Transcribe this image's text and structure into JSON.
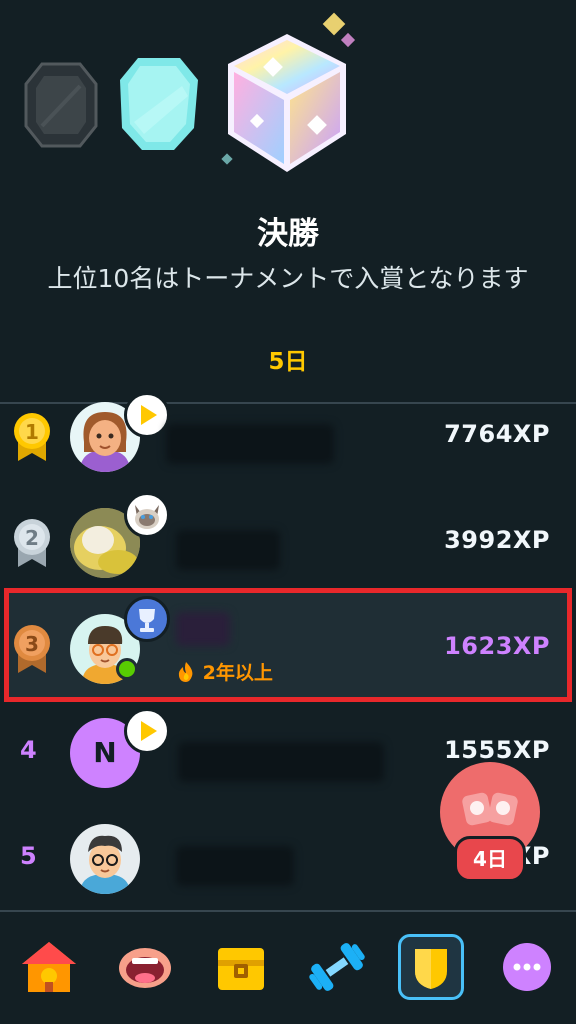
{
  "league": {
    "title": "決勝",
    "subtitle": "上位10名はトーナメントで入賞となります",
    "days_left": "5日"
  },
  "leaderboard": [
    {
      "rank": "1",
      "name": "",
      "xp": "7764XP"
    },
    {
      "rank": "2",
      "name": "",
      "xp": "3992XP"
    },
    {
      "rank": "3",
      "name": "",
      "xp": "1623XP",
      "streak": "2年以上"
    },
    {
      "rank": "4",
      "name": "",
      "xp": "1555XP",
      "initial": "N"
    },
    {
      "rank": "5",
      "name": "",
      "xp": "XP"
    }
  ],
  "floating": {
    "days": "4日"
  },
  "nav": {
    "items": [
      "home-icon",
      "speak-icon",
      "treasure-chest-icon",
      "dumbbell-icon",
      "shield-icon",
      "more-icon"
    ]
  },
  "colors": {
    "background": "#131f24",
    "gold": "#ffc800",
    "purple": "#ce82ff",
    "highlight_border": "#e8282b",
    "streak": "#ff9600"
  }
}
